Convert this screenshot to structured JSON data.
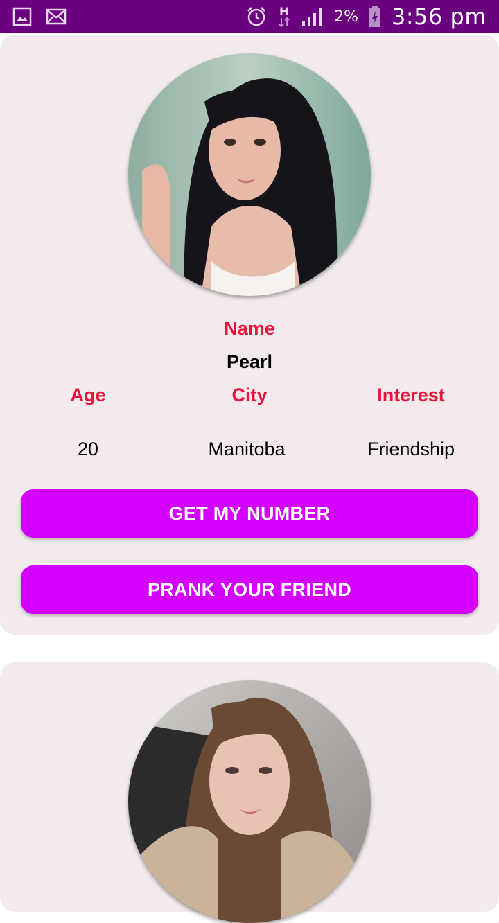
{
  "status_bar": {
    "icons_left": [
      "gallery-icon",
      "mail-icon"
    ],
    "icons_right": [
      "alarm-icon",
      "data-h-icon",
      "signal-icon",
      "battery-charging-icon"
    ],
    "battery_percent": "2%",
    "time": "3:56 pm"
  },
  "profiles": [
    {
      "avatar": "portrait-photo",
      "name_label": "Name",
      "name": "Pearl",
      "age_label": "Age",
      "city_label": "City",
      "interest_label": "Interest",
      "age": "20",
      "city": "Manitoba",
      "interest": "Friendship",
      "get_number_label": "GET MY NUMBER",
      "prank_label": "PRANK YOUR FRIEND"
    },
    {
      "avatar": "portrait-photo"
    }
  ],
  "colors": {
    "status_bar": "#6a0080",
    "card_bg": "#f2eaec",
    "label_red": "#e8143c",
    "button": "#d400ff"
  }
}
